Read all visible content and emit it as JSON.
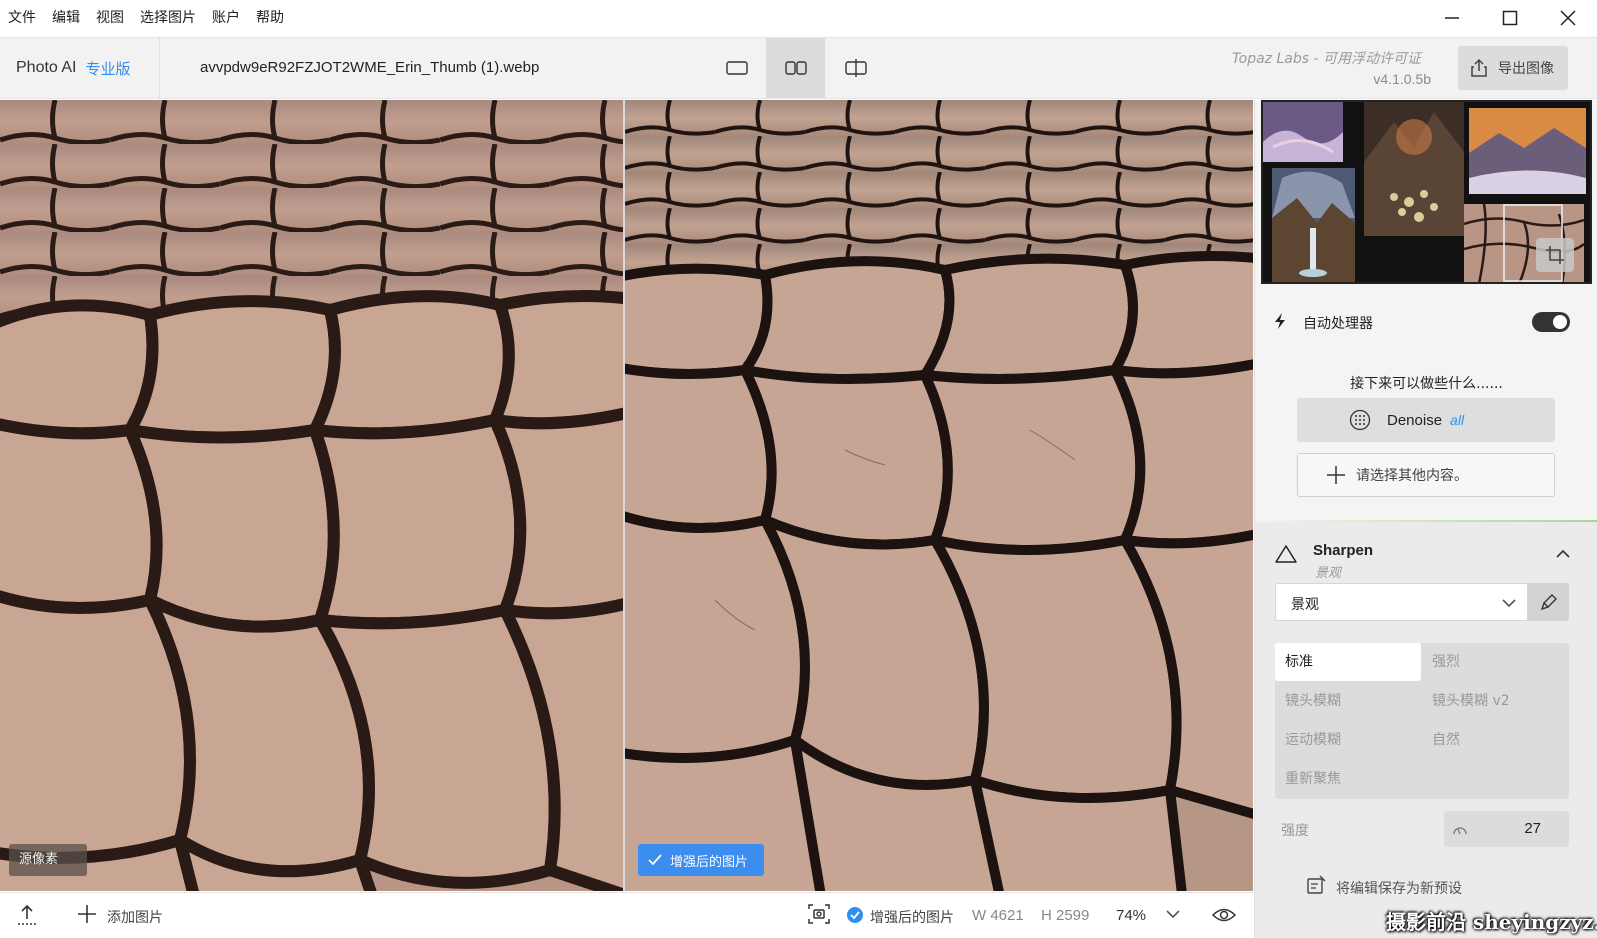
{
  "menu": [
    "文件",
    "编辑",
    "视图",
    "选择图片",
    "账户",
    "帮助"
  ],
  "header": {
    "app_name": "Photo AI",
    "edition": "专业版",
    "filename": "avvpdw9eR92FZJOT2WME_Erin_Thumb (1).webp",
    "license": "Topaz Labs - 可用浮动许可证",
    "version": "v4.1.0.5b",
    "export_label": "导出图像"
  },
  "panes": {
    "source_badge": "源像素",
    "enhanced_badge": "增强后的图片"
  },
  "bottom": {
    "add_label": "添加图片",
    "enhanced_label": "增强后的图片",
    "width": "W 4621",
    "height": "H 2599",
    "zoom": "74%"
  },
  "panel": {
    "auto_label": "自动处理器",
    "auto_enabled": true,
    "next_title": "接下来可以做些什么......",
    "denoise_label": "Denoise",
    "denoise_sub": "all",
    "other_label": "请选择其他内容。",
    "sharpen": {
      "title": "Sharpen",
      "subtitle": "景观",
      "select_value": "景观",
      "modes": [
        "标准",
        "强烈",
        "镜头模糊",
        "镜头模糊 v2",
        "运动模糊",
        "自然",
        "重新聚焦"
      ],
      "active_mode": "标准",
      "strength_label": "强度",
      "strength_value": "27"
    },
    "save_preset": "将编辑保存为新预设"
  },
  "watermark": "摄影前沿 sheyingzyz.com",
  "colors": {
    "accent": "#2f8ff0",
    "badge_enhanced": "#3b8df0",
    "mud_light": "#c9a594",
    "mud_dark": "#2b1b17"
  }
}
